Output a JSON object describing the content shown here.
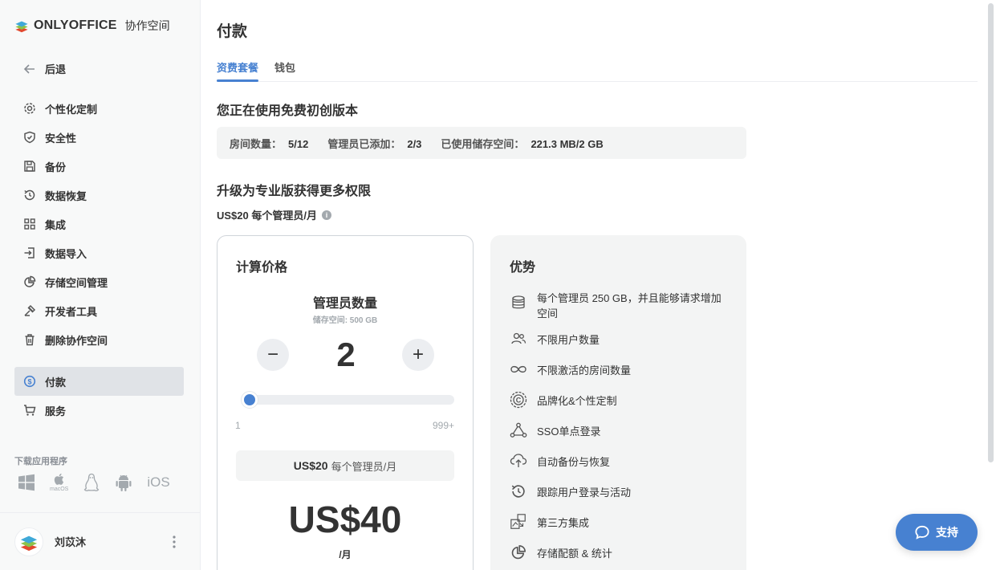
{
  "sidebar": {
    "logo_text": "ONLYOFFICE",
    "logo_sub": "协作空间",
    "back_label": "后退",
    "items": [
      {
        "label": "个性化定制",
        "icon": "gear-icon"
      },
      {
        "label": "安全性",
        "icon": "shield-icon"
      },
      {
        "label": "备份",
        "icon": "save-icon"
      },
      {
        "label": "数据恢复",
        "icon": "history-icon"
      },
      {
        "label": "集成",
        "icon": "grid-icon"
      },
      {
        "label": "数据导入",
        "icon": "import-icon"
      },
      {
        "label": "存储空间管理",
        "icon": "pie-chart-icon"
      },
      {
        "label": "开发者工具",
        "icon": "tools-icon"
      },
      {
        "label": "删除协作空间",
        "icon": "trash-icon"
      },
      {
        "label": "付款",
        "icon": "dollar-icon",
        "active": true
      },
      {
        "label": "服务",
        "icon": "cart-icon"
      }
    ],
    "download_label": "下载应用程序",
    "download_apps": [
      "windows-icon",
      "macos-icon",
      "linux-icon",
      "android-icon",
      "ios-icon"
    ],
    "macos_label": "macOS",
    "ios_label": "iOS",
    "user_name": "刘苡沐"
  },
  "main": {
    "title": "付款",
    "tabs": [
      {
        "label": "资费套餐",
        "active": true
      },
      {
        "label": "钱包"
      }
    ],
    "current_plan": "您正在使用免费初创版本",
    "stats": {
      "rooms_label": "房间数量：",
      "rooms_value": "5/12",
      "admins_label": "管理员已添加：",
      "admins_value": "2/3",
      "storage_label": "已使用储存空间：",
      "storage_value": "221.3 MB/2 GB"
    },
    "upgrade_title": "升级为专业版获得更多权限",
    "price_per_admin": "US$20 每个管理员/月",
    "calculator": {
      "title": "计算价格",
      "admins_title": "管理员数量",
      "storage_sub": "储存空间: 500 GB",
      "count": "2",
      "minus": "−",
      "plus": "+",
      "range_min": "1",
      "range_max": "999+",
      "slider_fraction": 0.001,
      "per_price": "US$20",
      "per_unit": "每个管理员/月",
      "total": "US$40",
      "total_unit": "/月"
    },
    "benefits": {
      "title": "优势",
      "items": [
        {
          "text": "每个管理员 250 GB，并且能够请求增加空间",
          "icon": "database-icon"
        },
        {
          "text": "不限用户数量",
          "icon": "users-icon"
        },
        {
          "text": "不限激活的房间数量",
          "icon": "infinity-icon"
        },
        {
          "text": "品牌化&个性定制",
          "icon": "branding-icon"
        },
        {
          "text": "SSO单点登录",
          "icon": "sso-icon"
        },
        {
          "text": "自动备份与恢复",
          "icon": "cloud-upload-icon"
        },
        {
          "text": "跟踪用户登录与活动",
          "icon": "history-icon"
        },
        {
          "text": "第三方集成",
          "icon": "puzzle-icon"
        },
        {
          "text": "存储配额 & 统计",
          "icon": "pie-chart-icon"
        }
      ]
    },
    "support_label": "支持"
  },
  "colors": {
    "accent": "#4781d1",
    "sidebar_bg": "#f8f9f9",
    "active_bg": "#e0e3e7"
  }
}
